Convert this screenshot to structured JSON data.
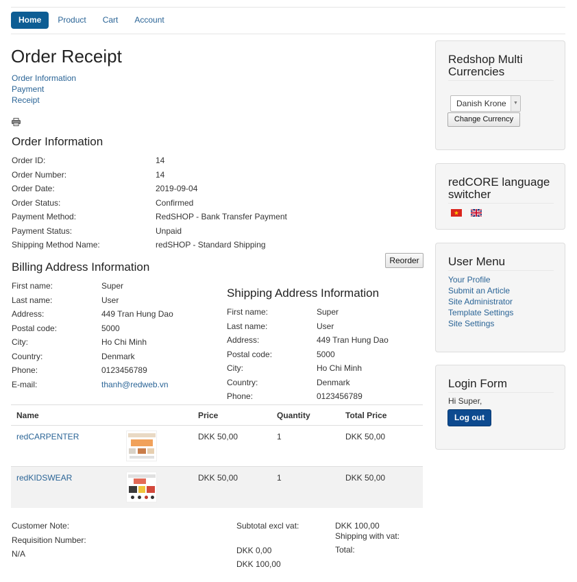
{
  "nav": {
    "items": [
      {
        "label": "Home",
        "active": true
      },
      {
        "label": "Product",
        "active": false
      },
      {
        "label": "Cart",
        "active": false
      },
      {
        "label": "Account",
        "active": false
      }
    ]
  },
  "page_title": "Order Receipt",
  "steps": [
    "Order Information",
    "Payment",
    "Receipt"
  ],
  "order_info": {
    "heading": "Order Information",
    "rows": [
      {
        "label": "Order ID:",
        "value": "14"
      },
      {
        "label": "Order Number:",
        "value": "14"
      },
      {
        "label": "Order Date:",
        "value": "2019-09-04"
      },
      {
        "label": "Order Status:",
        "value": "Confirmed"
      },
      {
        "label": "Payment Method:",
        "value": "RedSHOP - Bank Transfer Payment"
      },
      {
        "label": "Payment Status:",
        "value": "Unpaid"
      },
      {
        "label": "Shipping Method Name:",
        "value": "redSHOP - Standard Shipping"
      }
    ]
  },
  "reorder_label": "Reorder",
  "billing": {
    "heading": "Billing Address Information",
    "rows": [
      {
        "label": "First name:",
        "value": "Super"
      },
      {
        "label": "Last name:",
        "value": "User"
      },
      {
        "label": "Address:",
        "value": "449 Tran Hung Dao"
      },
      {
        "label": "Postal code:",
        "value": "5000"
      },
      {
        "label": "City:",
        "value": "Ho Chi Minh"
      },
      {
        "label": "Country:",
        "value": "Denmark"
      },
      {
        "label": "Phone:",
        "value": "0123456789"
      },
      {
        "label": "E-mail:",
        "value": "thanh@redweb.vn"
      }
    ]
  },
  "shipping": {
    "heading": "Shipping Address Information",
    "rows": [
      {
        "label": "First name:",
        "value": "Super"
      },
      {
        "label": "Last name:",
        "value": "User"
      },
      {
        "label": "Address:",
        "value": "449 Tran Hung Dao"
      },
      {
        "label": "Postal code:",
        "value": "5000"
      },
      {
        "label": "City:",
        "value": "Ho Chi Minh"
      },
      {
        "label": "Country:",
        "value": "Denmark"
      },
      {
        "label": "Phone:",
        "value": "0123456789"
      }
    ]
  },
  "table": {
    "headers": [
      "Name",
      "",
      "Price",
      "Quantity",
      "Total Price"
    ],
    "rows": [
      {
        "name": "redCARPENTER",
        "price": "DKK 50,00",
        "quantity": "1",
        "total": "DKK 50,00"
      },
      {
        "name": "redKIDSWEAR",
        "price": "DKK 50,00",
        "quantity": "1",
        "total": "DKK 50,00"
      }
    ]
  },
  "summary": {
    "customer_note_label": "Customer Note:",
    "requisition_label": "Requisition Number:",
    "requisition_value": "N/A",
    "subtotal_label": "Subtotal excl vat:",
    "subtotal_value": "DKK 100,00",
    "shipping_label": "Shipping with vat:",
    "shipping_value": "DKK 0,00",
    "total_label": "Total:",
    "total_value": "DKK 100,00"
  },
  "sidebar": {
    "currency": {
      "title": "Redshop Multi Currencies",
      "selected": "Danish Krone",
      "button": "Change Currency"
    },
    "language": {
      "title": "redCORE language switcher",
      "flags": [
        "vietnam-flag-icon",
        "uk-flag-icon"
      ]
    },
    "user_menu": {
      "title": "User Menu",
      "links": [
        "Your Profile",
        "Submit an Article",
        "Site Administrator",
        "Template Settings",
        "Site Settings"
      ]
    },
    "login": {
      "title": "Login Form",
      "greeting": "Hi Super,",
      "logout": "Log out"
    }
  },
  "colors": {
    "accent": "#0d5d94",
    "link": "#2a6496",
    "logout_button": "#0d4a8f"
  }
}
